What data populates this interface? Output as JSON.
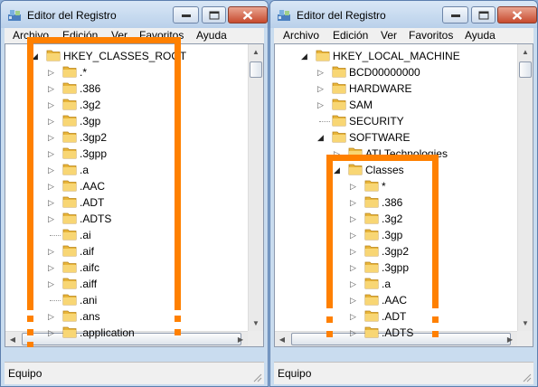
{
  "colors": {
    "highlight": "#ff8000",
    "folder": "#f5c54a",
    "titlebar": "#c9dcef"
  },
  "left_window": {
    "title": "Editor del Registro",
    "menu": [
      "Archivo",
      "Edición",
      "Ver",
      "Favoritos",
      "Ayuda"
    ],
    "root": "HKEY_CLASSES_ROOT",
    "items": [
      ".*",
      ".386",
      ".3g2",
      ".3gp",
      ".3gp2",
      ".3gpp",
      ".a",
      ".AAC",
      ".ADT",
      ".ADTS",
      ".ai",
      ".aif",
      ".aifc",
      ".aiff",
      ".ani",
      ".ans",
      ".application"
    ],
    "status": "Equipo"
  },
  "right_window": {
    "title": "Editor del Registro",
    "menu": [
      "Archivo",
      "Edición",
      "Ver",
      "Favoritos",
      "Ayuda"
    ],
    "root": "HKEY_LOCAL_MACHINE",
    "top_items": [
      "BCD00000000",
      "HARDWARE",
      "SAM",
      "SECURITY",
      "SOFTWARE"
    ],
    "software_child": "ATI Technologies",
    "classes": "Classes",
    "class_items": [
      "*",
      ".386",
      ".3g2",
      ".3gp",
      ".3gp2",
      ".3gpp",
      ".a",
      ".AAC",
      ".ADT",
      ".ADTS"
    ],
    "status": "Equipo"
  }
}
